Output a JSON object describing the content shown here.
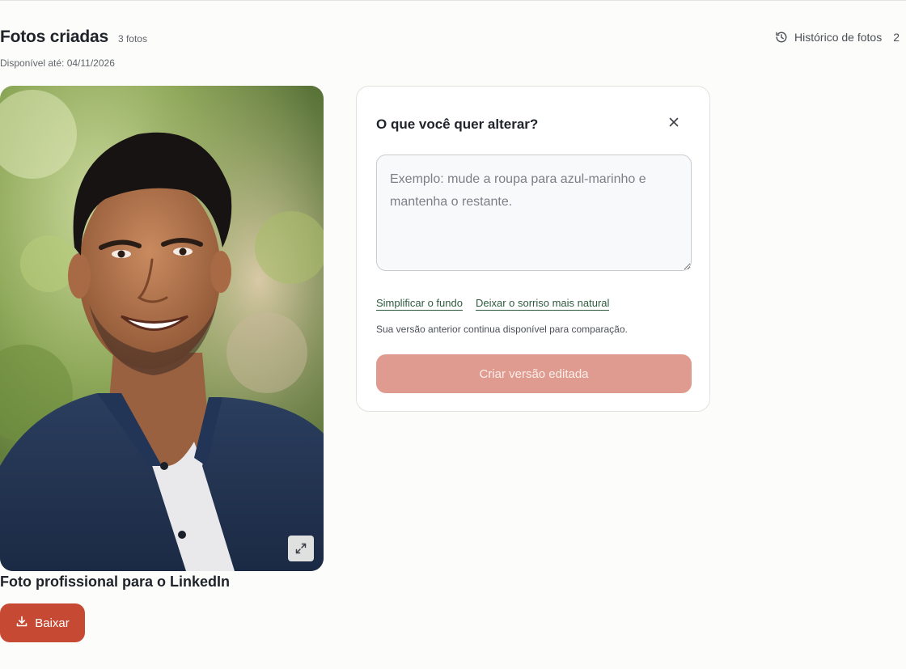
{
  "header": {
    "title": "Fotos criadas",
    "photo_count": "3 fotos",
    "availability": "Disponível até: 04/11/2026",
    "history_label": "Histórico de fotos",
    "history_count": "2",
    "history_icon": "history-icon"
  },
  "photo": {
    "caption": "Foto profissional para o LinkedIn",
    "expand_icon": "expand-icon",
    "download_label": "Baixar",
    "download_icon": "download-icon"
  },
  "edit_panel": {
    "title": "O que você quer alterar?",
    "close_icon": "close-icon",
    "textarea_value": "",
    "textarea_placeholder": "Exemplo: mude a roupa para azul-marinho e mantenha o restante.",
    "suggestions": [
      "Simplificar o fundo",
      "Deixar o sorriso mais natural"
    ],
    "note": "Sua versão anterior continua disponível para comparação.",
    "submit_label": "Criar versão editada"
  },
  "colors": {
    "accent": "#c64a33",
    "accent_disabled": "#df9b8f",
    "link": "#2e5b3e",
    "background": "#fcfcfa"
  }
}
